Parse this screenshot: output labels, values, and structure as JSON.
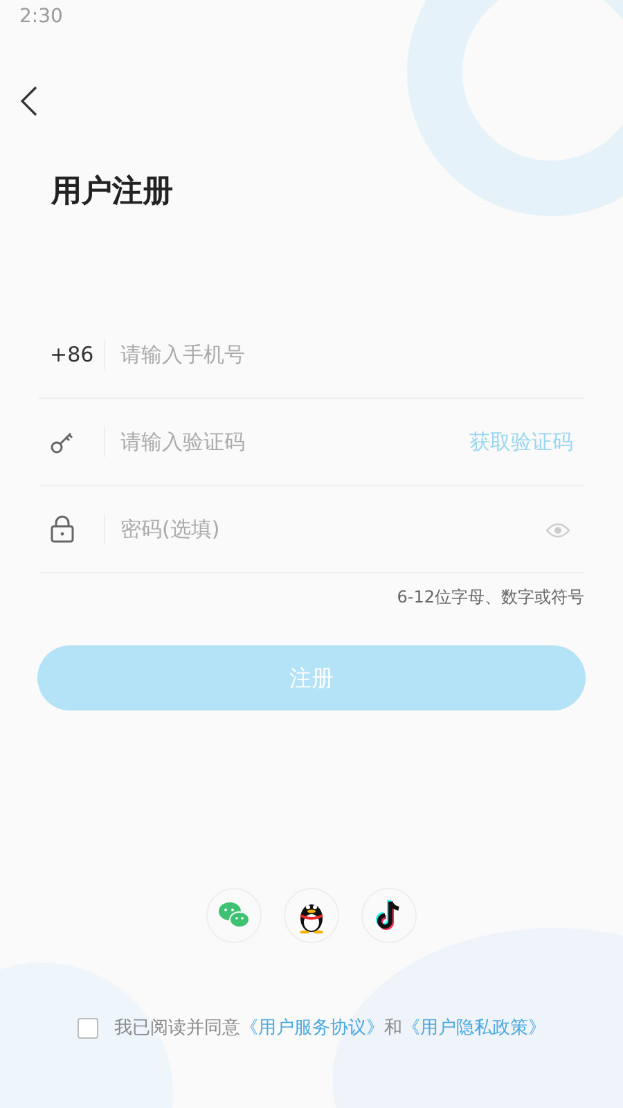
{
  "status_bar": {
    "time": "2:30"
  },
  "title": "用户注册",
  "fields": [
    {
      "kind": "phone",
      "prefix": "+86",
      "placeholder": "请输入手机号"
    },
    {
      "kind": "code",
      "placeholder": "请输入验证码",
      "action": "获取验证码"
    },
    {
      "kind": "password",
      "placeholder": "密码(选填)"
    }
  ],
  "password_hint": "6-12位字母、数字或符号",
  "submit": {
    "label": "注册",
    "disabled": true
  },
  "social": [
    {
      "kind": "wechat"
    },
    {
      "kind": "qq"
    },
    {
      "kind": "tiktok"
    }
  ],
  "agreement": {
    "checked": false,
    "text": "我已阅读并同意",
    "link1": "《用户服务协议》",
    "joiner": "和",
    "link2": "《用户隐私政策》"
  }
}
